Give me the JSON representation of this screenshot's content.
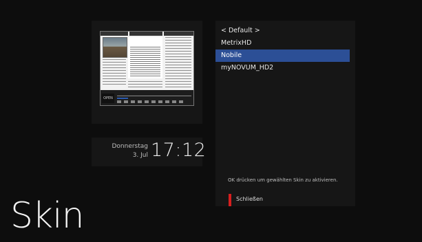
{
  "page": {
    "title": "Skin"
  },
  "clock": {
    "day": "Donnerstag",
    "date": "3. Jul",
    "time": "17:12"
  },
  "skins": {
    "items": [
      {
        "label": "< Default >"
      },
      {
        "label": "MetrixHD"
      },
      {
        "label": "Nobile",
        "selected": true
      },
      {
        "label": "myNOVUM_HD2"
      }
    ]
  },
  "hint": {
    "text": "OK drücken um gewählten Skin zu aktivieren."
  },
  "buttons": {
    "close_label": "Schließen"
  },
  "colors": {
    "selection": "#2c4f96",
    "red_key": "#d71f1f",
    "background": "#0d0d0d"
  },
  "preview": {
    "logo_text": "OPEN"
  }
}
